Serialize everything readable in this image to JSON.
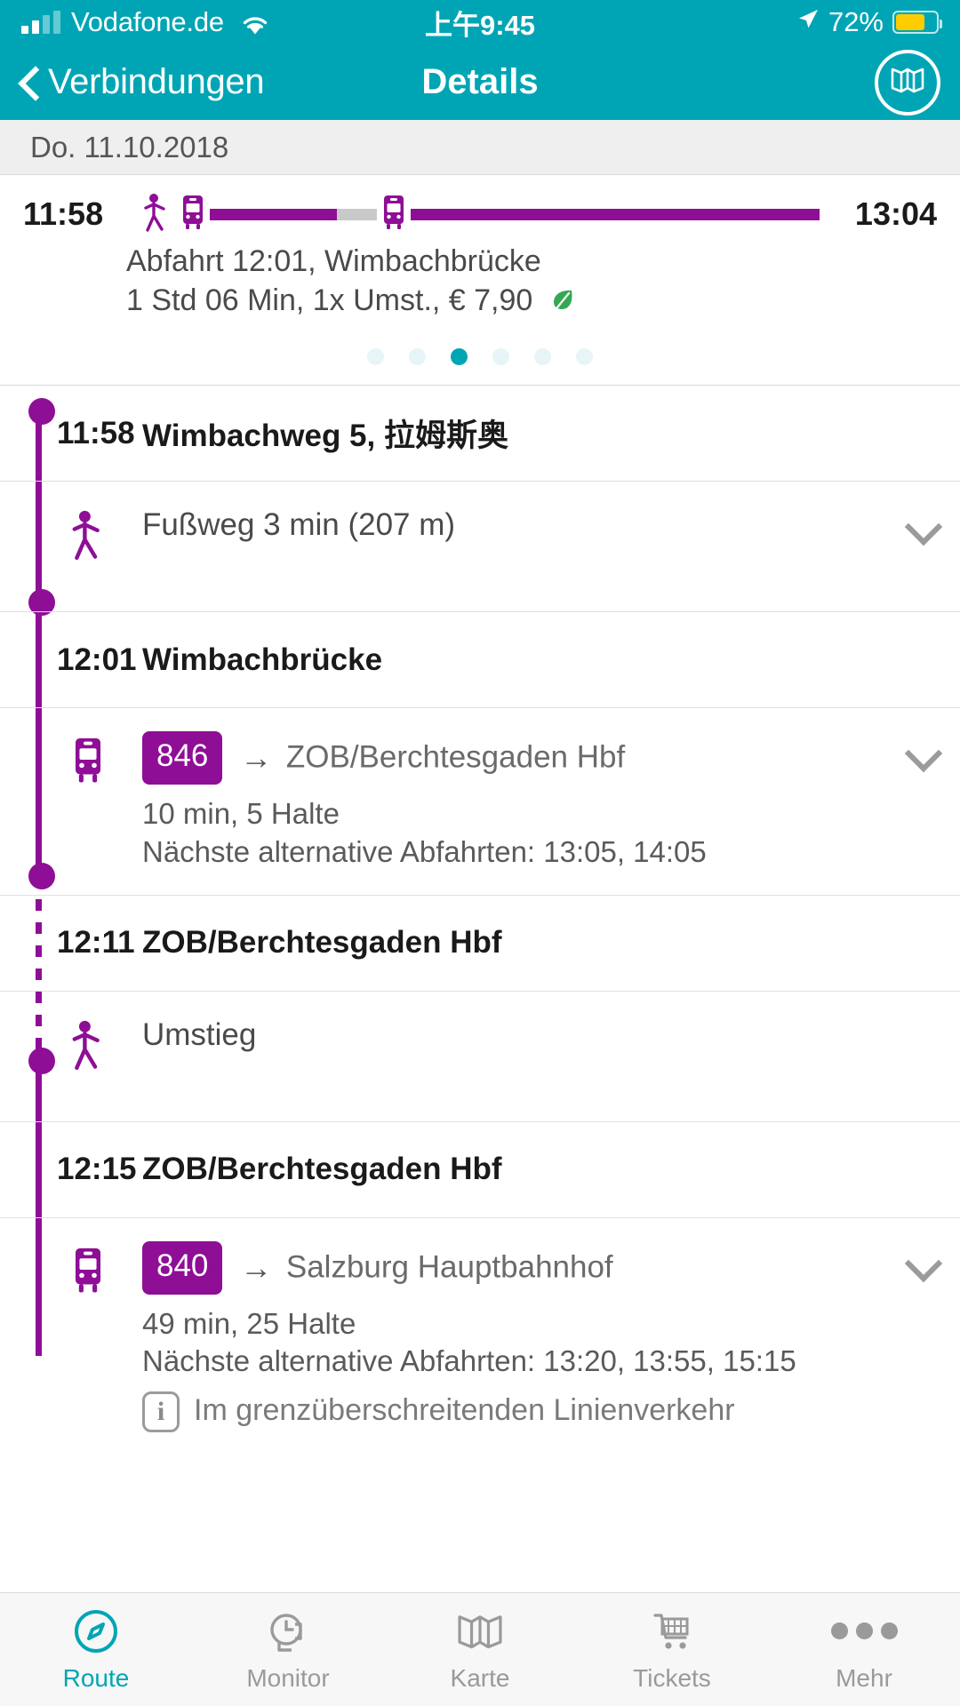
{
  "status_bar": {
    "carrier": "Vodafone.de",
    "time": "上午9:45",
    "battery_percent": "72%",
    "wifi_icon": "wifi-icon",
    "signal_icon": "signal-bars-icon",
    "location_icon": "location-arrow-icon",
    "battery_icon": "battery-icon"
  },
  "nav": {
    "back_label": "Verbindungen",
    "title": "Details",
    "back_icon": "chevron-left-icon",
    "map_icon": "map-icon"
  },
  "date_bar": {
    "date": "Do. 11.10.2018"
  },
  "summary": {
    "start_time": "11:58",
    "end_time": "13:04",
    "departure_line": "Abfahrt 12:01, Wimbachbrücke",
    "info_line": "1 Std 06 Min,  1x Umst.,  € 7,90",
    "eco_icon": "leaf-icon",
    "walk_icon": "pedestrian-icon",
    "bus_icon": "bus-icon",
    "pagination": {
      "count": 6,
      "active_index": 2
    },
    "segments": [
      {
        "type": "ride",
        "flex": 22,
        "color": "#8E0E96"
      },
      {
        "type": "gap",
        "flex": 7,
        "color": "#C9C9C9"
      },
      {
        "type": "ride",
        "flex": 71,
        "color": "#8E0E96"
      }
    ]
  },
  "itinerary": [
    {
      "kind": "stop",
      "time": "11:58",
      "name": "Wimbachweg 5, 拉姆斯奥"
    },
    {
      "kind": "leg",
      "mode": "walk",
      "icon": "pedestrian-icon",
      "title": "Fußweg 3 min (207 m)",
      "expandable": true,
      "chevron_icon": "chevron-down-icon"
    },
    {
      "kind": "stop",
      "time": "12:01",
      "name": "Wimbachbrücke"
    },
    {
      "kind": "leg",
      "mode": "bus",
      "icon": "bus-icon",
      "line": "846",
      "arrow": "→",
      "destination": "ZOB/Berchtesgaden Hbf",
      "duration": "10 min, 5 Halte",
      "alternatives": "Nächste alternative Abfahrten: 13:05, 14:05",
      "expandable": true,
      "chevron_icon": "chevron-down-icon"
    },
    {
      "kind": "stop",
      "time": "12:11",
      "name": "ZOB/Berchtesgaden Hbf"
    },
    {
      "kind": "leg",
      "mode": "walk",
      "icon": "pedestrian-icon",
      "title": "Umstieg",
      "expandable": false
    },
    {
      "kind": "stop",
      "time": "12:15",
      "name": "ZOB/Berchtesgaden Hbf"
    },
    {
      "kind": "leg",
      "mode": "bus",
      "icon": "bus-icon",
      "line": "840",
      "arrow": "→",
      "destination": "Salzburg Hauptbahnhof",
      "duration": "49 min, 25 Halte",
      "alternatives": "Nächste alternative Abfahrten: 13:20, 13:55, 15:15",
      "notice": "Im grenzüberschreitenden Linienverkehr",
      "notice_icon": "info-icon",
      "expandable": true,
      "chevron_icon": "chevron-down-icon"
    }
  ],
  "tabbar": {
    "items": [
      {
        "label": "Route",
        "icon": "compass-icon",
        "active": true
      },
      {
        "label": "Monitor",
        "icon": "watch-clock-icon",
        "active": false
      },
      {
        "label": "Karte",
        "icon": "map-icon",
        "active": false
      },
      {
        "label": "Tickets",
        "icon": "shopping-cart-icon",
        "active": false
      },
      {
        "label": "Mehr",
        "icon": "ellipsis-icon",
        "active": false
      }
    ]
  },
  "colors": {
    "brand_teal": "#00A5B5",
    "transit_purple": "#8E0E96",
    "eco_green": "#34A853",
    "battery_yellow": "#FFCC00"
  }
}
